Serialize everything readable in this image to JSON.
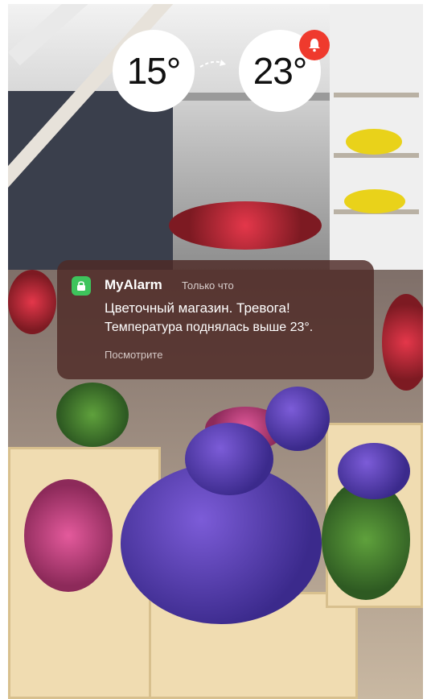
{
  "temperature": {
    "from": "15°",
    "to": "23°"
  },
  "notification": {
    "app_name": "MyAlarm",
    "time": "Только что",
    "title": "Цветочный магазин. Тревога!",
    "body": "Температура поднялась выше 23°.",
    "action": "Посмотрите"
  },
  "icons": {
    "arrow": "dashed-arrow-icon",
    "alert": "bell-icon",
    "app": "lock-icon"
  },
  "colors": {
    "alert_badge": "#ef3a2d",
    "app_icon": "#3ec45c",
    "notification_bg": "#4e2a26"
  }
}
